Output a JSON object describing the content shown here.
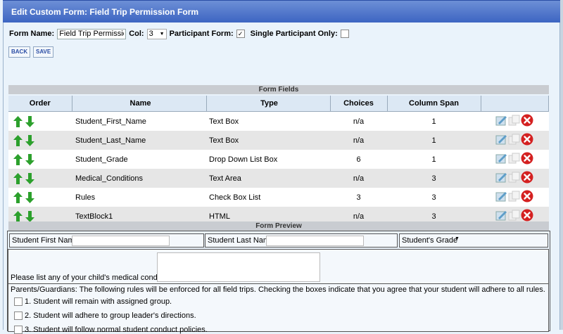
{
  "header": {
    "title": "Edit Custom Form: Field Trip Permission Form"
  },
  "form": {
    "name_label": "Form Name:",
    "name_value": "Field Trip Permission",
    "col_label": "Col:",
    "col_value": "3",
    "participant_label": "Participant Form:",
    "participant_checked": true,
    "single_label": "Single Participant Only:",
    "single_checked": false
  },
  "buttons": {
    "back": "BACK",
    "save": "SAVE"
  },
  "fields_section": {
    "title": "Form Fields",
    "columns": [
      "Order",
      "Name",
      "Type",
      "Choices",
      "Column Span",
      ""
    ],
    "rows": [
      {
        "name": "Student_First_Name",
        "type": "Text Box",
        "choices": "n/a",
        "span": "1"
      },
      {
        "name": "Student_Last_Name",
        "type": "Text Box",
        "choices": "n/a",
        "span": "1"
      },
      {
        "name": "Student_Grade",
        "type": "Drop Down List Box",
        "choices": "6",
        "span": "1"
      },
      {
        "name": "Medical_Conditions",
        "type": "Text Area",
        "choices": "n/a",
        "span": "3"
      },
      {
        "name": "Rules",
        "type": "Check Box List",
        "choices": "3",
        "span": "3"
      },
      {
        "name": "TextBlock1",
        "type": "HTML",
        "choices": "n/a",
        "span": "3"
      }
    ]
  },
  "preview": {
    "title": "Form Preview",
    "first_name_label": "Student First Name",
    "last_name_label": "Student Last Name",
    "grade_label": "Student's Grade",
    "medical_label": "Please list any of your child's medical condtions",
    "rules_text": "Parents/Guardians: The following rules will be enforced for all field trips. Checking the boxes indicate that you agree that your student will adhere to all rules.",
    "rules": [
      "1. Student will remain with assigned group.",
      "2. Student will adhere to group leader's directions.",
      "3. Student will follow normal student conduct policies."
    ]
  },
  "colors": {
    "title_bar": "#3d65c2",
    "arrow_green": "#2ca02c",
    "delete_red": "#d42020"
  }
}
